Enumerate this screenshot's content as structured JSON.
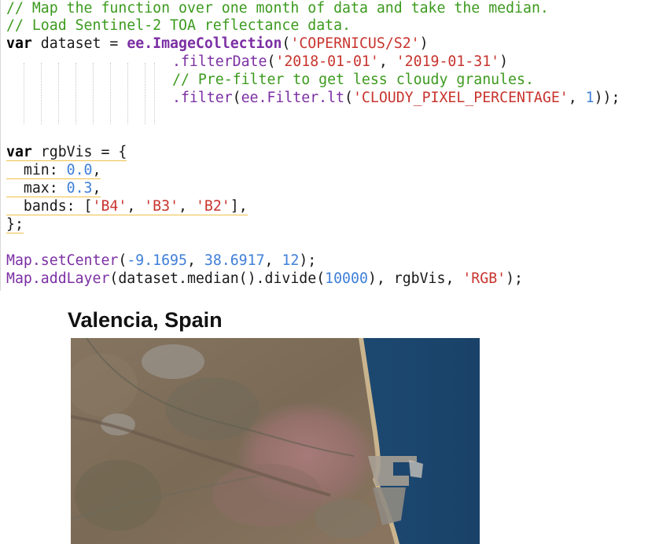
{
  "code": {
    "comment1": "// Map the function over one month of data and take the median.",
    "comment2": "// Load Sentinel-2 TOA reflectance data.",
    "kw_var": "var",
    "dataset_var": " dataset = ",
    "ee_image_collection": "ee.ImageCollection",
    "paren_open": "(",
    "collection_id": "'COPERNICUS/S2'",
    "paren_close": ")",
    "filter_date_fn": ".filterDate",
    "date_start": "'2018-01-01'",
    "comma_space": ", ",
    "date_end": "'2019-01-31'",
    "comment3": "// Pre-filter to get less cloudy granules.",
    "filter_fn": ".filter",
    "ee_filter_lt": "ee.Filter.lt",
    "cloudy_property": "'CLOUDY_PIXEL_PERCENTAGE'",
    "cloudy_value": "1",
    "end_stmt": "));",
    "rgbvis_decl": " rgbVis = {",
    "min_key": "  min: ",
    "min_value": "0.0",
    "max_key": "  max: ",
    "max_value": "0.3",
    "bands_key": "  bands: [",
    "band1": "'B4'",
    "band2": "'B3'",
    "band3": "'B2'",
    "bands_end": "],",
    "trailing_comma": ",",
    "close_brace": "};",
    "set_center_fn": "Map.setCenter",
    "center_lon": "-9.1695",
    "center_lat": "38.6917",
    "center_zoom": "12",
    "set_center_end": ");",
    "add_layer_fn": "Map.addLayer",
    "add_layer_args": "(dataset.median().divide(",
    "divide_value": "10000",
    "add_layer_mid": "), rgbVis, ",
    "layer_name": "'RGB'",
    "add_layer_end": ");"
  },
  "map": {
    "title": "Valencia, Spain"
  },
  "colors": {
    "comment": "#3c9a1e",
    "string": "#c8342e",
    "number": "#3f7fd8",
    "function": "#7b2fa3",
    "underline": "#f0c04a",
    "sea": "#1f4f7a",
    "land": "#7d6c58"
  }
}
